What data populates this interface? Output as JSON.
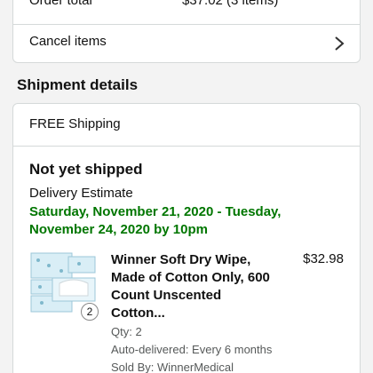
{
  "order_summary": {
    "total_label": "Order total",
    "total_value": "$37.02 (3 items)",
    "cancel_label": "Cancel items"
  },
  "shipment": {
    "heading": "Shipment details",
    "shipping_type": "FREE Shipping",
    "status": "Not yet shipped",
    "estimate_label": "Delivery Estimate",
    "estimate_date": "Saturday, November 21, 2020 - Tuesday, November 24, 2020 by 10pm",
    "estimate_color": "#007600"
  },
  "item": {
    "title": "Winner Soft Dry Wipe, Made of Cotton Only, 600 Count Unscented Cotton...",
    "price": "$32.98",
    "qty_badge": "2",
    "qty": "Qty: 2",
    "auto_delivery": "Auto-delivered: Every 6 months",
    "seller": "Sold By: WinnerMedical"
  }
}
